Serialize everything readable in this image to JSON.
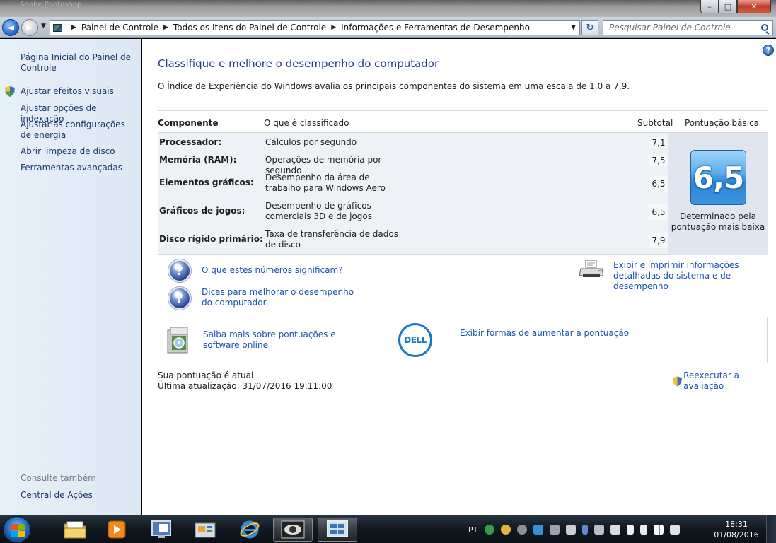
{
  "window": {
    "title_ghost": "Adobe Photoshop",
    "minimize_glyph": "–",
    "maximize_glyph": "□",
    "close_glyph": "✕"
  },
  "nav": {
    "back_glyph": "◄",
    "forward_glyph": "►",
    "breadcrumbs": [
      "Painel de Controle",
      "Todos os Itens do Painel de Controle",
      "Informações e Ferramentas de Desempenho"
    ],
    "search_placeholder": "Pesquisar Painel de Controle",
    "refresh_glyph": "↻"
  },
  "sidebar": {
    "items": [
      {
        "label": "Página Inicial do Painel de Controle"
      },
      {
        "label": "Ajustar efeitos visuais",
        "icon": "uac-shield-icon"
      },
      {
        "label": "Ajustar opções de indexação"
      },
      {
        "label": "Ajustar as configurações de energia"
      },
      {
        "label": "Abrir limpeza de disco"
      },
      {
        "label": "Ferramentas avançadas"
      }
    ],
    "see_also_title": "Consulte também",
    "see_also": [
      {
        "label": "Central de Ações"
      }
    ]
  },
  "main": {
    "help_glyph": "?",
    "title": "Classifique e melhore o desempenho do computador",
    "intro": "O Índice de Experiência do Windows avalia os principais componentes do sistema em uma escala de 1,0 a 7,9.",
    "table": {
      "headers": {
        "component": "Componente",
        "rated": "O que é classificado",
        "subtotal": "Subtotal",
        "base_score": "Pontuação básica"
      },
      "rows": [
        {
          "component": "Processador:",
          "description": "Cálculos por segundo",
          "subtotal": "7,1"
        },
        {
          "component": "Memória (RAM):",
          "description": "Operações de memória por segundo",
          "subtotal": "7,5"
        },
        {
          "component": "Elementos gráficos:",
          "description": "Desempenho da área de trabalho para Windows Aero",
          "subtotal": "6,5"
        },
        {
          "component": "Gráficos de jogos:",
          "description": "Desempenho de gráficos comerciais 3D e de jogos",
          "subtotal": "6,5"
        },
        {
          "component": "Disco rígido primário:",
          "description": "Taxa de transferência de dados de disco",
          "subtotal": "7,9"
        }
      ],
      "base_score": "6,5",
      "base_caption": "Determinado pela pontuação mais baixa"
    },
    "links": {
      "meaning": "O que estes números significam?",
      "tips": "Dicas para melhorar o desempenho do computador.",
      "print": "Exibir e imprimir informações detalhadas do sistema e de desempenho"
    },
    "promo": {
      "learn_more": "Saiba mais sobre pontuações e software online",
      "dell_logo": "DELL",
      "increase": "Exibir formas de aumentar a pontuação"
    },
    "status": {
      "current": "Sua pontuação é atual",
      "last_update": "Última atualização: 31/07/2016 19:11:00",
      "rerun": "Reexecutar a avaliação"
    }
  },
  "taskbar": {
    "pinned": [
      "explorer-folder-icon",
      "media-player-icon",
      "remote-desktop-icon",
      "control-panel-icon",
      "internet-explorer-icon",
      "photo-viewer-icon",
      "performance-info-icon"
    ],
    "language": "PT",
    "time": "18:31",
    "date": "01/08/2016",
    "colors": {
      "accent_link": "#1a50b4",
      "title_blue": "#1e3a8a",
      "table_bg": "#eef2f7"
    }
  }
}
